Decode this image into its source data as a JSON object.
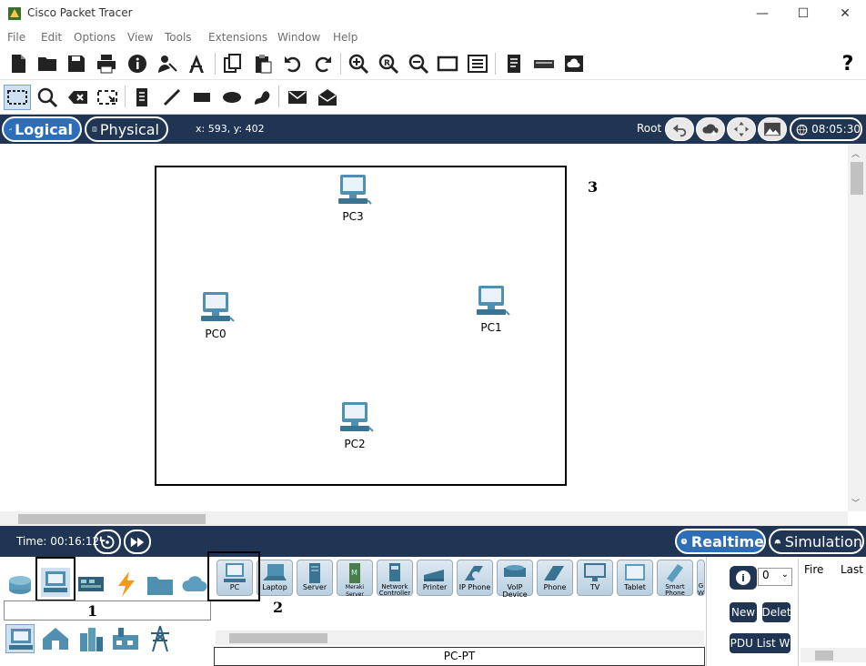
{
  "window": {
    "title": "Cisco Packet Tracer",
    "controls": {
      "minimize": "—",
      "maximize": "☐",
      "close": "✕"
    }
  },
  "menu": [
    "File",
    "Edit",
    "Options",
    "View",
    "Tools",
    "Extensions",
    "Window",
    "Help"
  ],
  "toolbar1": {
    "icons": [
      "new-file-icon",
      "open-folder-icon",
      "save-icon",
      "print-icon",
      "info-icon",
      "activity-wizard-icon",
      "network-info-icon",
      "copy-icon",
      "paste-icon",
      "undo-icon",
      "redo-icon",
      "zoom-in-icon",
      "zoom-reset-icon",
      "zoom-out-icon",
      "drawing-palette-icon",
      "custom-devices-icon",
      "text-icon",
      "switch-device-icon",
      "cloud-image-icon"
    ],
    "help": "?"
  },
  "toolbar2": {
    "icons": [
      "select-icon",
      "inspect-icon",
      "delete-icon",
      "resize-icon",
      "note-icon",
      "line-icon",
      "rectangle-icon",
      "ellipse-icon",
      "freeform-icon",
      "add-pdu-icon",
      "add-complex-pdu-icon"
    ]
  },
  "logical_bar": {
    "logical_label": "Logical",
    "physical_label": "Physical",
    "coords": "x: 593, y: 402",
    "root_label": "Root",
    "clock": "08:05:30"
  },
  "workspace": {
    "devices": [
      {
        "name": "PC3"
      },
      {
        "name": "PC0"
      },
      {
        "name": "PC1"
      },
      {
        "name": "PC2"
      }
    ],
    "annotations": [
      "1",
      "2",
      "3"
    ]
  },
  "timebar": {
    "time": "Time: 00:16:12",
    "realtime_label": "Realtime",
    "simulation_label": "Simulation"
  },
  "device_categories": {
    "row1": [
      "network-devices-icon",
      "end-devices-icon",
      "components-icon",
      "connections-icon",
      "miscellaneous-icon",
      "multiuser-icon"
    ],
    "row2": [
      "end-devices-icon",
      "home-icon",
      "smart-city-icon",
      "industrial-icon",
      "power-grid-icon"
    ]
  },
  "device_tiles": [
    {
      "label": "PC"
    },
    {
      "label": "Laptop"
    },
    {
      "label": "Server"
    },
    {
      "label": "Meraki Server"
    },
    {
      "label": "Network Controller"
    },
    {
      "label": "Printer"
    },
    {
      "label": "IP Phone"
    },
    {
      "label": "VoIP Device"
    },
    {
      "label": "Phone"
    },
    {
      "label": "TV"
    },
    {
      "label": "Tablet"
    },
    {
      "label": "Smart Phone"
    },
    {
      "label": "G W"
    }
  ],
  "selected_device_name": "PC-PT",
  "pdu_panel": {
    "info_label": "i",
    "scenario_value": "0",
    "new_label": "New",
    "delete_label": "Delet",
    "pdu_list_label": "PDU List W",
    "columns": [
      "Fire",
      "Last"
    ]
  },
  "colors": {
    "navy": "#1f3553",
    "accent_blue": "#2c6fb8",
    "device_teal": "#4f8fb0"
  }
}
